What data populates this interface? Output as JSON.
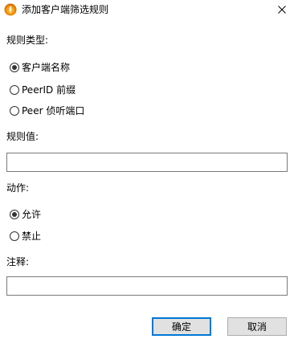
{
  "window": {
    "title": "添加客户端筛选规则",
    "icon": "app-flame-icon",
    "close_icon": "close-icon"
  },
  "rule_type": {
    "label": "规则类型:",
    "options": [
      {
        "label": "客户端名称",
        "checked": true
      },
      {
        "label": "PeerID 前缀",
        "checked": false
      },
      {
        "label": "Peer 侦听端口",
        "checked": false
      }
    ]
  },
  "rule_value": {
    "label": "规则值:",
    "value": ""
  },
  "action": {
    "label": "动作:",
    "options": [
      {
        "label": "允许",
        "checked": true
      },
      {
        "label": "禁止",
        "checked": false
      }
    ]
  },
  "comment": {
    "label": "注释:",
    "value": ""
  },
  "buttons": {
    "ok": "确定",
    "cancel": "取消"
  },
  "colors": {
    "accent": "#0078d7",
    "button_bg": "#e1e1e1",
    "border": "#7a7a7a"
  }
}
